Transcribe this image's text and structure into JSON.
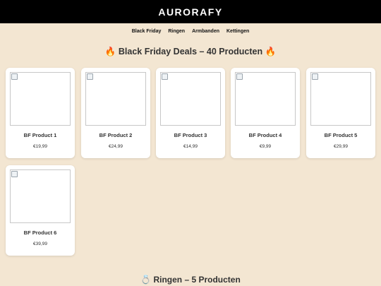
{
  "header": {
    "brand": "AURORAFY"
  },
  "nav": {
    "items": [
      "Black Friday",
      "Ringen",
      "Armbanden",
      "Kettingen"
    ]
  },
  "sections": [
    {
      "title": "🔥 Black Friday Deals – 40 Producten 🔥",
      "products": [
        {
          "name": "BF Product 1",
          "price": "€19,99"
        },
        {
          "name": "BF Product 2",
          "price": "€24,99"
        },
        {
          "name": "BF Product 3",
          "price": "€14,99"
        },
        {
          "name": "BF Product 4",
          "price": "€9,99"
        },
        {
          "name": "BF Product 5",
          "price": "€29,99"
        },
        {
          "name": "BF Product 6",
          "price": "€39,99"
        }
      ]
    },
    {
      "title": "💍 Ringen – 5 Producten"
    }
  ],
  "colors": {
    "background": "#f3e6d2",
    "topbar": "#000000",
    "card": "#ffffff"
  }
}
